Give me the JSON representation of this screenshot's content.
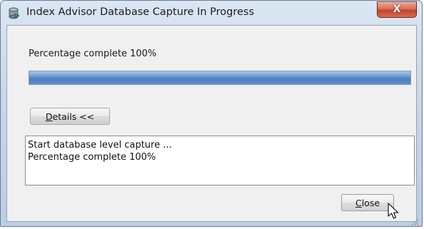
{
  "window": {
    "title": "Index Advisor Database Capture In Progress",
    "icon": "database-icon",
    "close_glyph": "X"
  },
  "progress": {
    "label": "Percentage complete 100%",
    "percent": 100,
    "accent": "#4a7fc3"
  },
  "details_button": {
    "mnemonic": "D",
    "rest": "etails <<"
  },
  "log": {
    "lines": [
      "Start database level capture ...",
      "Percentage complete 100%"
    ]
  },
  "close_button": {
    "mnemonic": "C",
    "rest": "lose"
  }
}
